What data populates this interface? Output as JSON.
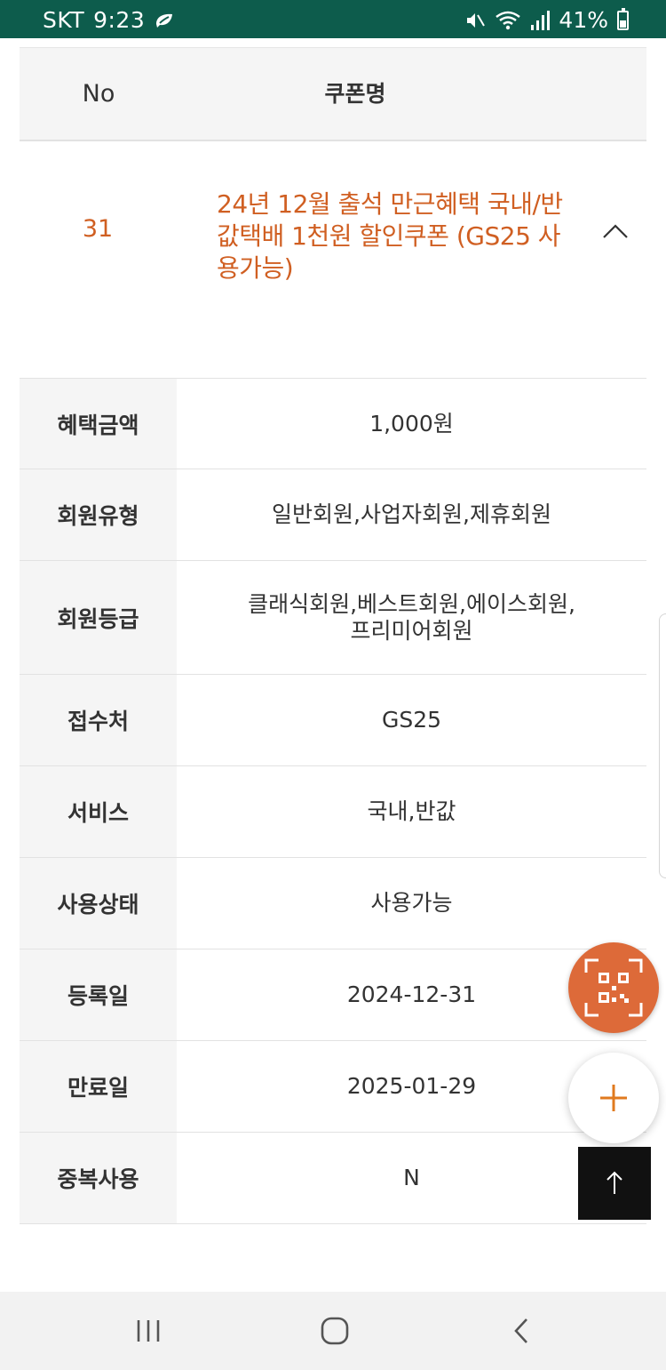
{
  "status_bar": {
    "carrier": "SKT",
    "time": "9:23",
    "battery": "41%",
    "battery_level": 0.41
  },
  "table_header": {
    "no": "No",
    "name": "쿠폰명"
  },
  "coupon": {
    "number": "31",
    "title": "24년 12월 출석 만근혜택 국내/반값택배 1천원 할인쿠폰 (GS25 사용가능)",
    "expanded": true
  },
  "details": [
    {
      "label": "혜택금액",
      "value": "1,000원"
    },
    {
      "label": "회원유형",
      "value": "일반회원,사업자회원,제휴회원"
    },
    {
      "label": "회원등급",
      "value": "클래식회원,베스트회원,에이스회원,\n프리미어회원"
    },
    {
      "label": "접수처",
      "value": "GS25"
    },
    {
      "label": "서비스",
      "value": "국내,반값"
    },
    {
      "label": "사용상태",
      "value": "사용가능"
    },
    {
      "label": "등록일",
      "value": "2024-12-31"
    },
    {
      "label": "만료일",
      "value": "2025-01-29"
    },
    {
      "label": "중복사용",
      "value": "N"
    }
  ],
  "colors": {
    "status_bar": "#0d5c4c",
    "accent": "#d05f22",
    "qr_button": "#dd6a39",
    "label_bg": "#f5f5f5"
  },
  "icons": {
    "qr_button": "qr-scan-icon",
    "plus_button": "plus-icon",
    "top_button": "arrow-up-icon",
    "nav_recent": "recent-apps-icon",
    "nav_home": "home-icon",
    "nav_back": "back-icon"
  }
}
